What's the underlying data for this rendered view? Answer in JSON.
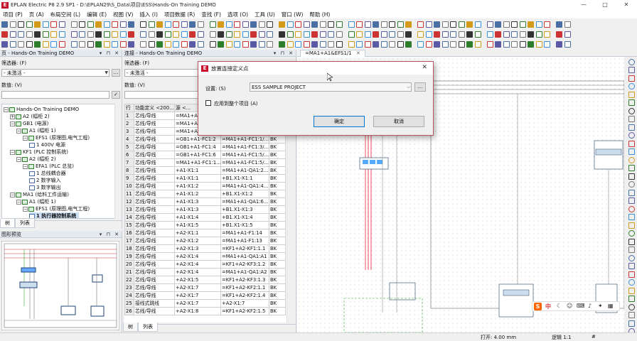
{
  "window": {
    "title": "EPLAN Electric P8 2.9 SP1 - D:\\EPLAN29\\S_Data\\项目\\ESS\\Hands-On Training DEMO",
    "controls": [
      "—",
      "□",
      "✕"
    ]
  },
  "menu": [
    "项目 (P)",
    "页 (A)",
    "布局空间 (L)",
    "编辑 (E)",
    "视图 (V)",
    "插入 (I)",
    "项目数据 (R)",
    "查找 (F)",
    "选项 (O)",
    "工具 (U)",
    "窗口 (W)",
    "帮助 (H)"
  ],
  "page_panel": {
    "title": "页 - Hands-On Training DEMO",
    "filter_label": "筛选器: (F)",
    "filter_value": "- 未激活 -",
    "value_label": "数值: (V)",
    "tree": [
      {
        "level": 0,
        "label": "Hands-On Training DEMO",
        "expander": "−",
        "kind": "folder"
      },
      {
        "level": 1,
        "label": "A2 (幅柜 2)",
        "expander": "+",
        "kind": "folder"
      },
      {
        "level": 1,
        "label": "GB1 (电源)",
        "expander": "−",
        "kind": "folder"
      },
      {
        "level": 2,
        "label": "A1 (幅柜 1)",
        "expander": "−",
        "kind": "folder"
      },
      {
        "level": 3,
        "label": "EFS1 (原理图,电气工程)",
        "expander": "−",
        "kind": "folder"
      },
      {
        "level": 4,
        "label": "1 400V 电源",
        "expander": "",
        "kind": "doc"
      },
      {
        "level": 1,
        "label": "KF1 (PLC 控制系统)",
        "expander": "−",
        "kind": "folder"
      },
      {
        "level": 2,
        "label": "A2 (幅柜 2)",
        "expander": "−",
        "kind": "folder"
      },
      {
        "level": 3,
        "label": "EFA1 (PLC 总览)",
        "expander": "−",
        "kind": "folder"
      },
      {
        "level": 4,
        "label": "1 总线耦合器",
        "expander": "",
        "kind": "doc"
      },
      {
        "level": 4,
        "label": "2 数字输入",
        "expander": "",
        "kind": "doc"
      },
      {
        "level": 4,
        "label": "3 数字输出",
        "expander": "",
        "kind": "doc"
      },
      {
        "level": 1,
        "label": "MA1 (给料工件运输)",
        "expander": "−",
        "kind": "folder"
      },
      {
        "level": 2,
        "label": "A1 (幅柜 1)",
        "expander": "−",
        "kind": "folder"
      },
      {
        "level": 3,
        "label": "EFS1 (原理图,电气工程)",
        "expander": "−",
        "kind": "folder"
      },
      {
        "level": 4,
        "label": "1 执行器控制系统",
        "expander": "",
        "kind": "doc",
        "bold": true
      }
    ],
    "tabs": [
      "树",
      "列表"
    ]
  },
  "preview_panel": {
    "title": "图形预览"
  },
  "connection_panel": {
    "title": "连接 - Hands-On Training DEMO",
    "filter_label": "筛选器: (F)",
    "filter_value": "- 未激活 -",
    "value_label": "数值: (V)",
    "columns": [
      "行",
      "功能定义 <200...",
      "源 <...",
      "",
      ""
    ],
    "rows": [
      [
        "1",
        "芯线/导线",
        "=MA1+A",
        "",
        ""
      ],
      [
        "2",
        "芯线/导线",
        "=MA1+A",
        "",
        ""
      ],
      [
        "3",
        "芯线/导线",
        "=MA1+A",
        "",
        ""
      ],
      [
        "4",
        "芯线/导线",
        "=GB1+A1-FC1:2",
        "=MA1+A1-FC1:1/...",
        "BK"
      ],
      [
        "5",
        "芯线/导线",
        "=GB1+A1-FC1:4",
        "=MA1+A1-FC1:3/...",
        "BK"
      ],
      [
        "6",
        "芯线/导线",
        "=GB1+A1-FC1:6",
        "=MA1+A1-FC1:5/...",
        "BK"
      ],
      [
        "7",
        "芯线/导线",
        "=MA1+A1-FC1:1...",
        "=MA1+A1-FC1:5/...",
        "BK"
      ],
      [
        "8",
        "芯线/导线",
        "+A1-X1:1",
        "=MA1+A1-QA1:2...",
        "BK"
      ],
      [
        "9",
        "芯线/导线",
        "+A1-X1:1",
        "+B1.X1-X1:1",
        "BK"
      ],
      [
        "10",
        "芯线/导线",
        "+A1-X1:2",
        "=MA1+A1-QA1:4...",
        "BK"
      ],
      [
        "11",
        "芯线/导线",
        "+A1-X1:2",
        "+B1.X1-X1:2",
        "BK"
      ],
      [
        "12",
        "芯线/导线",
        "+A1-X1:3",
        "=MA1+A1-QA1:6...",
        "BK"
      ],
      [
        "13",
        "芯线/导线",
        "+A1-X1:3",
        "+B1.X1-X1:3",
        "BK"
      ],
      [
        "14",
        "芯线/导线",
        "+A1-X1:4",
        "+B1.X1-X1:4",
        "BK"
      ],
      [
        "15",
        "芯线/导线",
        "+A1-X1:5",
        "+B1.X1-X1:5",
        "BK"
      ],
      [
        "16",
        "芯线/导线",
        "+A2-X1:1",
        "=MA1+A1-F1:14",
        "BK"
      ],
      [
        "17",
        "芯线/导线",
        "+A2-X1:2",
        "=MA1+A1-F1:13",
        "BK"
      ],
      [
        "18",
        "芯线/导线",
        "+A2-X1:3",
        "=KF1+A2-KF1:1.1",
        "BK"
      ],
      [
        "19",
        "芯线/导线",
        "+A2-X1:4",
        "=MA1+A1-QA1:A1",
        "BK"
      ],
      [
        "20",
        "芯线/导线",
        "+A2-X1:4",
        "=KF1+A2-KF3:1.2",
        "BK"
      ],
      [
        "21",
        "芯线/导线",
        "+A2-X1:4",
        "=MA1+A1-QA1:A2",
        "BK"
      ],
      [
        "22",
        "芯线/导线",
        "+A2-X1:5",
        "=KF1+A2-KF3:1.3",
        "BK"
      ],
      [
        "23",
        "芯线/导线",
        "+A2-X1:7",
        "=KF1+A2-KF2:1.1",
        "BK"
      ],
      [
        "24",
        "芯线/导线",
        "+A2-X1:7",
        "=KF1+A2-KF2:1.4",
        "BK"
      ],
      [
        "25",
        "接线式跳线",
        "+A2-X1:7",
        "+A2-X1:7",
        "BK"
      ],
      [
        "26",
        "芯线/导线",
        "+A2-X1:8",
        "=KF1+A2-KF2:1.5",
        "BK"
      ]
    ],
    "tabs": [
      "树",
      "列表"
    ]
  },
  "document_tab": {
    "label": "=MA1+A1&EFS1/1"
  },
  "dialog": {
    "title": "放置连接定义点",
    "setting_label": "设置: (S)",
    "setting_value": "ESS SAMPLE PROJECT",
    "browse_label": "...",
    "apply_label": "应用到整个项目 (A)",
    "ok_label": "确定",
    "cancel_label": "取消"
  },
  "status": {
    "open": "打开: 4.00 mm",
    "logic": "逻辑 1:1",
    "hash": "#"
  },
  "ime": {
    "s_label": "S",
    "zh_label": "中"
  },
  "colors": {
    "accent": "#c8102e",
    "tab_active": "#ffffff",
    "grid_line": "#cfcfcf",
    "selection": "#cce0f5"
  }
}
